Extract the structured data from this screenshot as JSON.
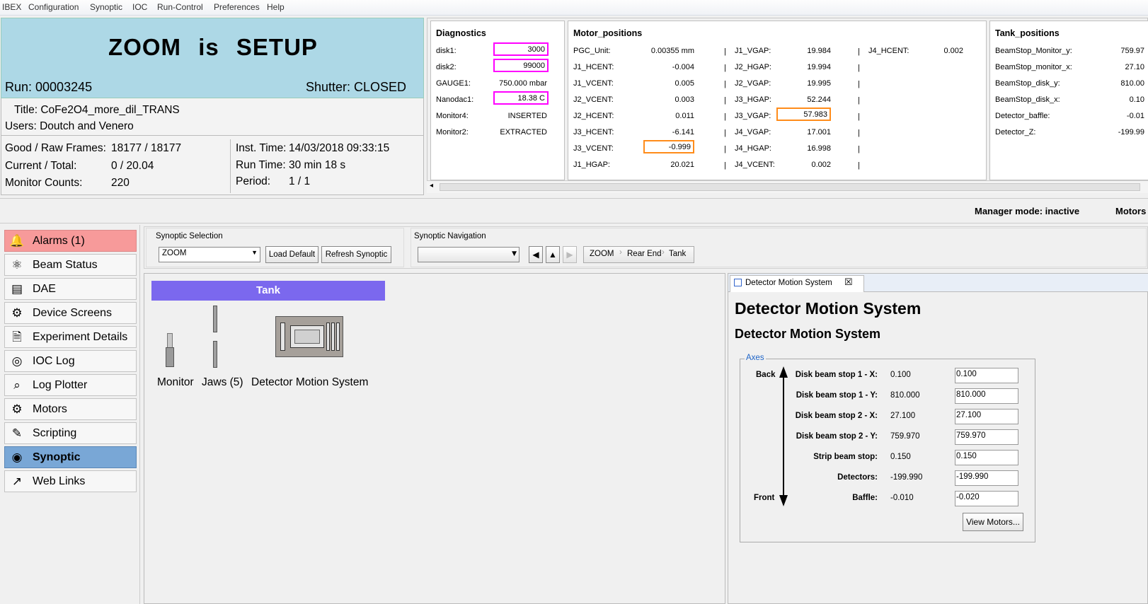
{
  "menu": [
    "IBEX",
    "Configuration",
    "Synoptic",
    "IOC",
    "Run-Control",
    "Preferences",
    "Help"
  ],
  "dashboard": {
    "instrument": "ZOOM",
    "is_word": "is",
    "state": "SETUP",
    "run": "Run: 00003245",
    "shutter": "Shutter: CLOSED",
    "title": "Title: CoFe2O4_more_dil_TRANS",
    "users": "Users: Doutch and Venero",
    "good_raw_label": "Good / Raw Frames:",
    "good_raw_value": "18177 / 18177",
    "current_total_label": "Current / Total:",
    "current_total_value": "0 / 20.04",
    "monitor_counts_label": "Monitor Counts:",
    "monitor_counts_value": "220",
    "inst_time_label": "Inst. Time:",
    "inst_time_value": "14/03/2018 09:33:15",
    "run_time_label": "Run Time:",
    "run_time_value": "30 min 18 s",
    "period_label": "Period:",
    "period_value": "1 / 1",
    "title_bg_color": "#add8e6"
  },
  "blocks": {
    "diagnostics": {
      "title": "Diagnostics",
      "rows": [
        {
          "label": "disk1:",
          "value": "3000",
          "highlight": "pink"
        },
        {
          "label": "disk2:",
          "value": "99000",
          "highlight": "pink"
        },
        {
          "label": "GAUGE1:",
          "value": "750.000 mbar",
          "highlight": ""
        },
        {
          "label": "Nanodac1:",
          "value": "18.38 C",
          "highlight": "pink"
        },
        {
          "label": "Monitor4:",
          "value": "INSERTED",
          "highlight": ""
        },
        {
          "label": "Monitor2:",
          "value": "EXTRACTED",
          "highlight": ""
        }
      ]
    },
    "motor_positions": {
      "title": "Motor_positions",
      "col1": [
        {
          "label": "PGC_Unit:",
          "value": "0.00355 mm",
          "highlight": ""
        },
        {
          "label": "J1_HCENT:",
          "value": "-0.004",
          "highlight": ""
        },
        {
          "label": "J1_VCENT:",
          "value": "0.005",
          "highlight": ""
        },
        {
          "label": "J2_VCENT:",
          "value": "0.003",
          "highlight": ""
        },
        {
          "label": "J2_HCENT:",
          "value": "0.011",
          "highlight": ""
        },
        {
          "label": "J3_HCENT:",
          "value": "-6.141",
          "highlight": ""
        },
        {
          "label": "J3_VCENT:",
          "value": "-0.999",
          "highlight": "orange"
        },
        {
          "label": "J1_HGAP:",
          "value": "20.021",
          "highlight": ""
        }
      ],
      "col2": [
        {
          "label": "J1_VGAP:",
          "value": "19.984",
          "highlight": ""
        },
        {
          "label": "J2_HGAP:",
          "value": "19.994",
          "highlight": ""
        },
        {
          "label": "J2_VGAP:",
          "value": "19.995",
          "highlight": ""
        },
        {
          "label": "J3_HGAP:",
          "value": "52.244",
          "highlight": ""
        },
        {
          "label": "J3_VGAP:",
          "value": "57.983",
          "highlight": "orange"
        },
        {
          "label": "J4_VGAP:",
          "value": "17.001",
          "highlight": ""
        },
        {
          "label": "J4_HGAP:",
          "value": "16.998",
          "highlight": ""
        },
        {
          "label": "J4_VCENT:",
          "value": "0.002",
          "highlight": ""
        }
      ],
      "col3": [
        {
          "label": "J4_HCENT:",
          "value": "0.002",
          "highlight": ""
        }
      ],
      "separator": "|"
    },
    "tank_positions": {
      "title": "Tank_positions",
      "rows": [
        {
          "label": "BeamStop_Monitor_y:",
          "value": "759.97"
        },
        {
          "label": "BeamStop_monitor_x:",
          "value": "27.10"
        },
        {
          "label": "BeamStop_disk_y:",
          "value": "810.00"
        },
        {
          "label": "BeamStop_disk_x:",
          "value": "0.10"
        },
        {
          "label": "Detector_baffle:",
          "value": "-0.01"
        },
        {
          "label": "Detector_Z:",
          "value": "-199.99"
        }
      ]
    }
  },
  "manager": {
    "mode": "Manager mode: inactive",
    "motors": "Motors"
  },
  "perspectives": [
    {
      "label": "Alarms (1)",
      "icon": "bell-icon",
      "glyph": "🔔",
      "state": "alarm"
    },
    {
      "label": "Beam Status",
      "icon": "atom-icon",
      "glyph": "⚛",
      "state": ""
    },
    {
      "label": "DAE",
      "icon": "server-icon",
      "glyph": "▤",
      "state": ""
    },
    {
      "label": "Device Screens",
      "icon": "device-screen-icon",
      "glyph": "⚙",
      "state": ""
    },
    {
      "label": "Experiment Details",
      "icon": "document-icon",
      "glyph": "🗎",
      "state": ""
    },
    {
      "label": "IOC Log",
      "icon": "log-icon",
      "glyph": "◎",
      "state": ""
    },
    {
      "label": "Log Plotter",
      "icon": "plot-icon",
      "glyph": "⌕",
      "state": ""
    },
    {
      "label": "Motors",
      "icon": "gears-icon",
      "glyph": "⚙",
      "state": ""
    },
    {
      "label": "Scripting",
      "icon": "script-icon",
      "glyph": "✎",
      "state": ""
    },
    {
      "label": "Synoptic",
      "icon": "globe-icon",
      "glyph": "◉",
      "state": "active"
    },
    {
      "label": "Web Links",
      "icon": "external-link-icon",
      "glyph": "↗",
      "state": ""
    }
  ],
  "synoptic_bar": {
    "selection_label": "Synoptic Selection",
    "selection_value": "ZOOM",
    "load_default": "Load Default",
    "refresh": "Refresh Synoptic",
    "navigation_label": "Synoptic Navigation",
    "breadcrumbs": [
      "ZOOM",
      "Rear End",
      "Tank"
    ]
  },
  "diagram": {
    "group_title": "Tank",
    "group_color": "#7b68ee",
    "components": [
      "Monitor",
      "Jaws (5)",
      "Detector Motion System"
    ]
  },
  "detector_panel": {
    "tab_label": "Detector Motion System",
    "heading": "Detector Motion System",
    "subheading": "Detector Motion System",
    "axes_legend": "Axes",
    "back_label": "Back",
    "front_label": "Front",
    "rows": [
      {
        "label": "Disk beam stop 1 - X:",
        "readback": "0.100",
        "setpoint": "0.100"
      },
      {
        "label": "Disk beam stop 1 - Y:",
        "readback": "810.000",
        "setpoint": "810.000"
      },
      {
        "label": "Disk beam stop 2 - X:",
        "readback": "27.100",
        "setpoint": "27.100"
      },
      {
        "label": "Disk beam stop 2 - Y:",
        "readback": "759.970",
        "setpoint": "759.970"
      },
      {
        "label": "Strip beam stop:",
        "readback": "0.150",
        "setpoint": "0.150"
      },
      {
        "label": "Detectors:",
        "readback": "-199.990",
        "setpoint": "-199.990"
      },
      {
        "label": "Baffle:",
        "readback": "-0.010",
        "setpoint": "-0.020"
      }
    ],
    "view_motors": "View Motors..."
  }
}
